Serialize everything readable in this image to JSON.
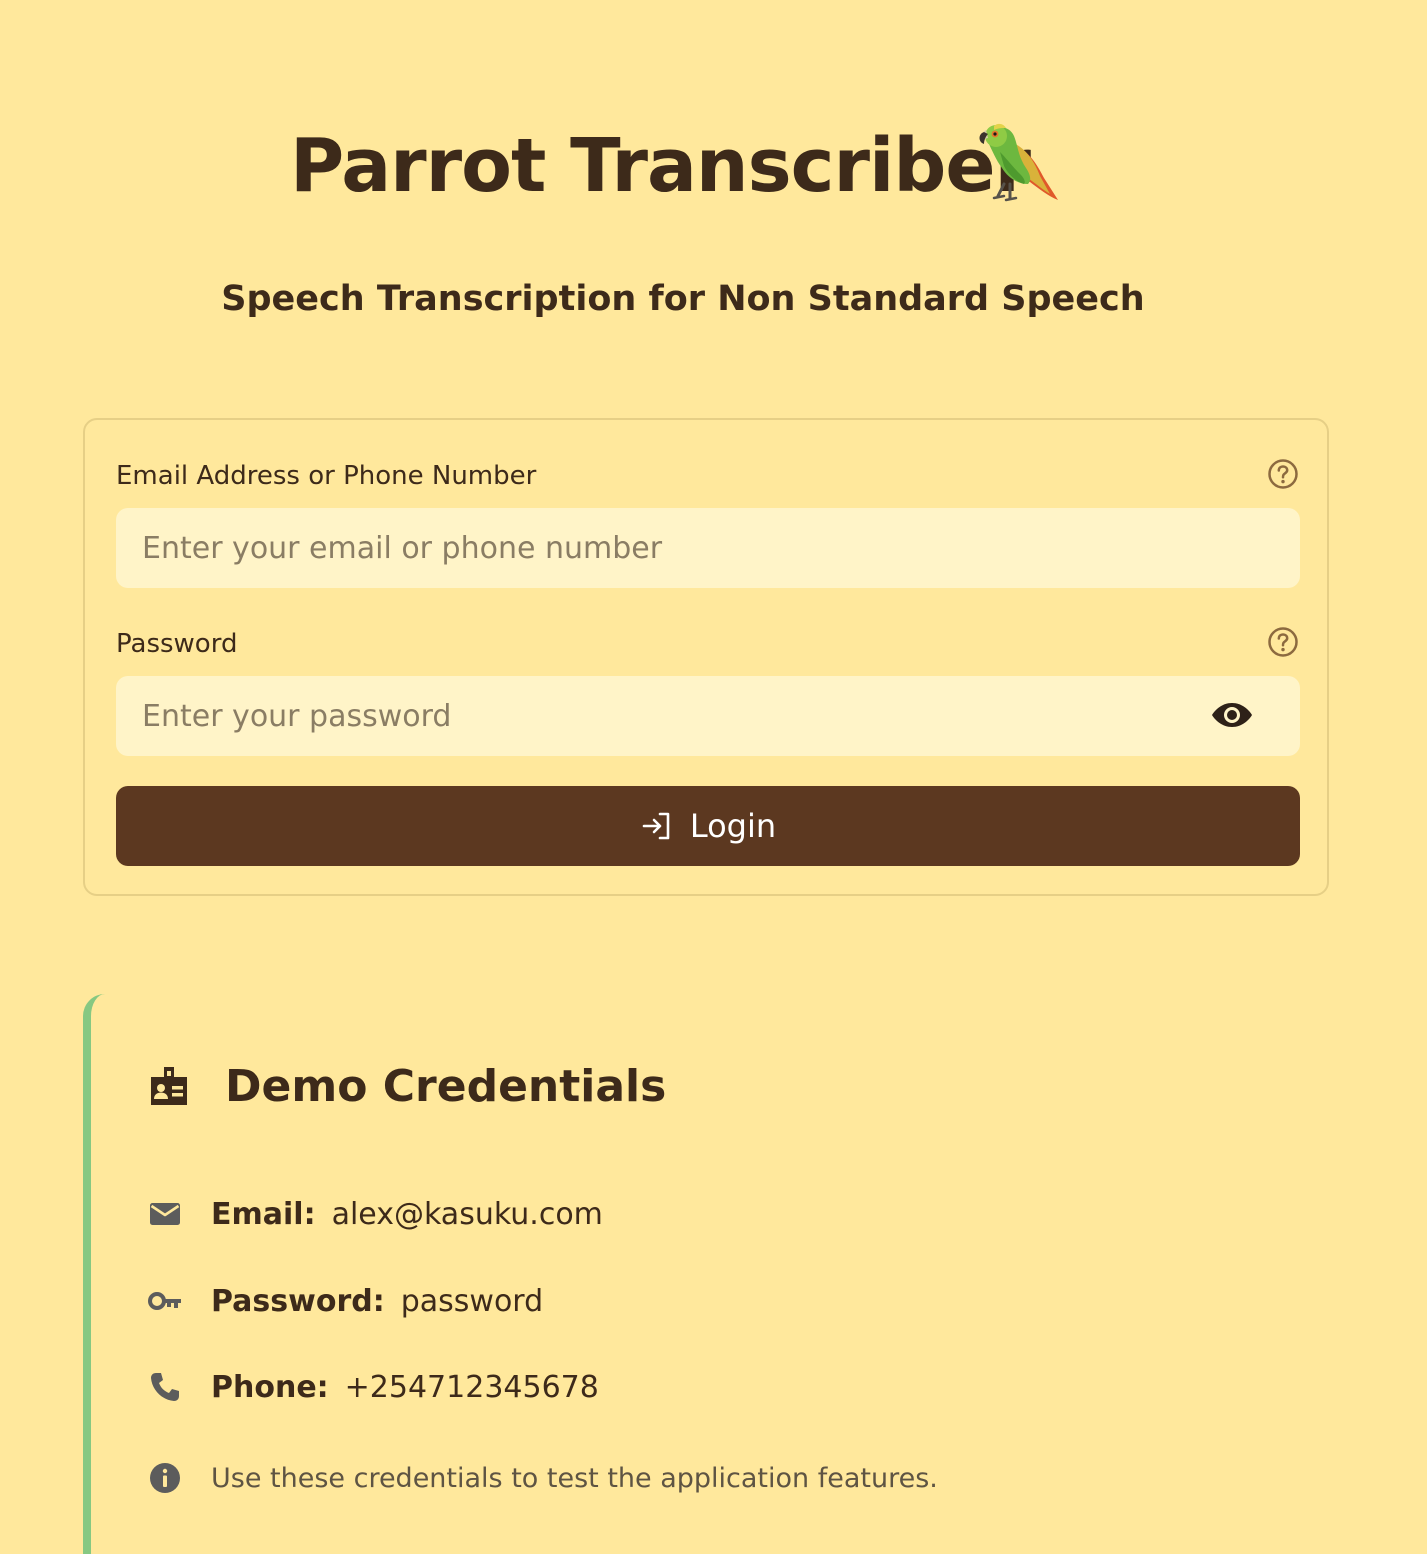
{
  "app": {
    "title": "Parrot Transcriber",
    "subtitle": "Speech Transcription for Non Standard Speech"
  },
  "login_form": {
    "email_label": "Email Address or Phone Number",
    "email_placeholder": "Enter your email or phone number",
    "email_value": "",
    "password_label": "Password",
    "password_placeholder": "Enter your password",
    "password_value": "",
    "login_button_label": "Login"
  },
  "demo_credentials": {
    "title": "Demo Credentials",
    "email_label": "Email:",
    "email_value": "alex@kasuku.com",
    "password_label": "Password:",
    "password_value": "password",
    "phone_label": "Phone:",
    "phone_value": "+254712345678",
    "note": "Use these credentials to test the application features."
  },
  "icons": {
    "title_emoji": "parrot-icon",
    "email_help": "help-circle-icon",
    "password_help": "help-circle-icon",
    "password_toggle": "eye-icon",
    "login": "login-icon",
    "demo_header": "badge-icon",
    "email_row": "mail-icon",
    "password_row": "key-icon",
    "phone_row": "phone-icon",
    "note_row": "info-icon"
  },
  "colors": {
    "background": "#FFE89C",
    "text": "#3D2A1A",
    "input_background": "#FFF4C8",
    "button_background": "#5C3820",
    "button_text": "#FFFFFF",
    "card_border": "#E6CF86",
    "accent_bar": "#86C882",
    "muted_icon": "#5C5C5C"
  }
}
